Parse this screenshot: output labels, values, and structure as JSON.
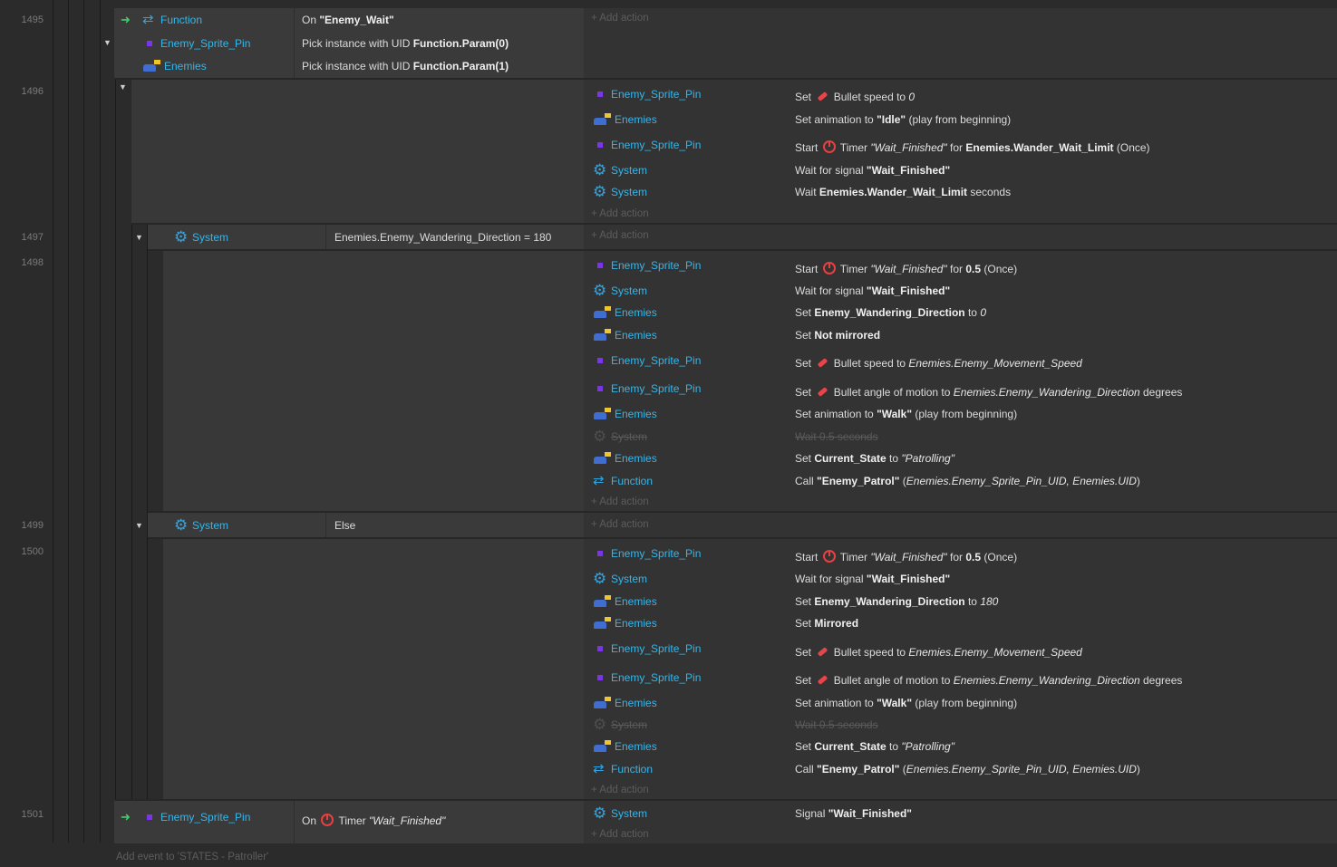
{
  "line_numbers": [
    "1495",
    "1496",
    "1497",
    "1498",
    "1499",
    "1500",
    "1501"
  ],
  "add_action": "Add action",
  "footer": "Add event to 'STATES - Patroller'",
  "ev1495": {
    "conditions": [
      {
        "obj": "Function",
        "text_pre": "On ",
        "text_b": "\"Enemy_Wait\""
      },
      {
        "obj": "Enemy_Sprite_Pin",
        "text_pre": "Pick instance with UID ",
        "text_b": "Function.Param(0)"
      },
      {
        "obj": "Enemies",
        "text_pre": "Pick instance with UID ",
        "text_b": "Function.Param(1)"
      }
    ]
  },
  "ev1496": {
    "actions": [
      {
        "obj": "Enemy_Sprite_Pin",
        "a": "Set ",
        "b": " Bullet speed to ",
        "c": "0"
      },
      {
        "obj": "Enemies",
        "a": "Set animation to ",
        "b": "\"Idle\"",
        "c": " (play from beginning)"
      },
      {
        "obj": "Enemy_Sprite_Pin",
        "a": "Start ",
        "b": " Timer ",
        "c": "\"Wait_Finished\"",
        "d": " for ",
        "e": "Enemies.Wander_Wait_Limit",
        "f": " (Once)"
      },
      {
        "obj": "System",
        "a": "Wait for signal ",
        "b": "\"Wait_Finished\""
      },
      {
        "obj": "System",
        "a": "Wait ",
        "b": "Enemies.Wander_Wait_Limit",
        "c": " seconds"
      }
    ]
  },
  "ev1497": {
    "obj": "System",
    "cond": "Enemies.Enemy_Wandering_Direction = 180"
  },
  "ev1498": {
    "actions": [
      {
        "obj": "Enemy_Sprite_Pin",
        "a": "Start ",
        "b": " Timer ",
        "c": "\"Wait_Finished\"",
        "d": " for ",
        "e": "0.5",
        "f": " (Once)"
      },
      {
        "obj": "System",
        "a": "Wait for signal ",
        "b": "\"Wait_Finished\""
      },
      {
        "obj": "Enemies",
        "a": "Set ",
        "b": "Enemy_Wandering_Direction",
        "c": " to ",
        "d": "0"
      },
      {
        "obj": "Enemies",
        "a": "Set ",
        "b": "Not mirrored"
      },
      {
        "obj": "Enemy_Sprite_Pin",
        "a": "Set ",
        "b": " Bullet speed to ",
        "c": "Enemies.Enemy_Movement_Speed"
      },
      {
        "obj": "Enemy_Sprite_Pin",
        "a": "Set ",
        "b": " Bullet angle of motion to ",
        "c": "Enemies.Enemy_Wandering_Direction",
        "d": " degrees"
      },
      {
        "obj": "Enemies",
        "a": "Set animation to ",
        "b": "\"Walk\"",
        "c": " (play from beginning)"
      },
      {
        "obj": "System",
        "a": "Wait ",
        "b": "0.5",
        "c": " seconds"
      },
      {
        "obj": "Enemies",
        "a": "Set ",
        "b": "Current_State",
        "c": " to ",
        "d": "\"Patrolling\""
      },
      {
        "obj": "Function",
        "a": "Call ",
        "b": "\"Enemy_Patrol\"",
        "c": " (",
        "d": "Enemies.Enemy_Sprite_Pin_UID, Enemies.UID",
        "e": ")"
      }
    ]
  },
  "ev1499": {
    "obj": "System",
    "cond": "Else"
  },
  "ev1500": {
    "actions": [
      {
        "obj": "Enemy_Sprite_Pin",
        "a": "Start ",
        "b": " Timer ",
        "c": "\"Wait_Finished\"",
        "d": " for ",
        "e": "0.5",
        "f": " (Once)"
      },
      {
        "obj": "System",
        "a": "Wait for signal ",
        "b": "\"Wait_Finished\""
      },
      {
        "obj": "Enemies",
        "a": "Set ",
        "b": "Enemy_Wandering_Direction",
        "c": " to ",
        "d": "180"
      },
      {
        "obj": "Enemies",
        "a": "Set ",
        "b": "Mirrored"
      },
      {
        "obj": "Enemy_Sprite_Pin",
        "a": "Set ",
        "b": " Bullet speed to ",
        "c": "Enemies.Enemy_Movement_Speed"
      },
      {
        "obj": "Enemy_Sprite_Pin",
        "a": "Set ",
        "b": " Bullet angle of motion to ",
        "c": "Enemies.Enemy_Wandering_Direction",
        "d": " degrees"
      },
      {
        "obj": "Enemies",
        "a": "Set animation to ",
        "b": "\"Walk\"",
        "c": " (play from beginning)"
      },
      {
        "obj": "System",
        "a": "Wait ",
        "b": "0.5",
        "c": " seconds"
      },
      {
        "obj": "Enemies",
        "a": "Set ",
        "b": "Current_State",
        "c": " to ",
        "d": "\"Patrolling\""
      },
      {
        "obj": "Function",
        "a": "Call ",
        "b": "\"Enemy_Patrol\"",
        "c": " (",
        "d": "Enemies.Enemy_Sprite_Pin_UID, Enemies.UID",
        "e": ")"
      }
    ]
  },
  "ev1501": {
    "cond_obj": "Enemy_Sprite_Pin",
    "cond_a": "On ",
    "cond_b": " Timer ",
    "cond_c": "\"Wait_Finished\"",
    "act_obj": "System",
    "act_a": "Signal ",
    "act_b": "\"Wait_Finished\""
  }
}
